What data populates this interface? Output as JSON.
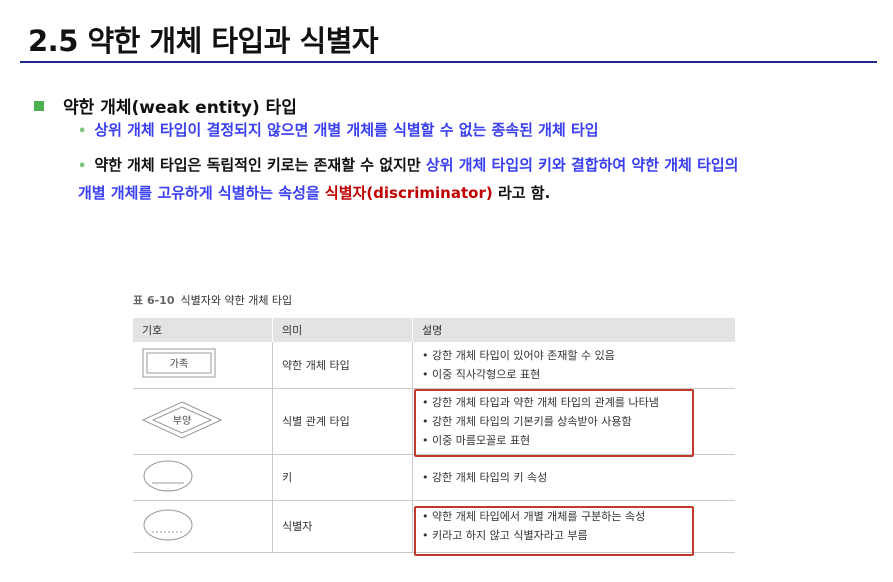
{
  "title": "2.5 약한 개체 타입과 식별자",
  "main_bullet": "약한 개체(weak entity) 타입",
  "sub1": "상위 개체 타입이 결정되지 않으면 개별 개체를 식별할 수 없는 종속된 개체 타입",
  "sub2": {
    "part1": "약한 개체 타입은 독립적인 키로는 존재할 수 없지만 ",
    "part2": "상위 개체 타입의 키와 결합하여 약한 개체 타입의",
    "part3": "개별 개체를 고유하게 식별하는 속성을 ",
    "part4": "식별자(discriminator)",
    "part5": " 라고 함."
  },
  "table": {
    "caption_num": "표 6-10",
    "caption_text": "식별자와 약한 개체 타입",
    "headers": [
      "기호",
      "의미",
      "설명"
    ],
    "rows": [
      {
        "symbol_text": "가족",
        "meaning": "약한 개체 타입",
        "desc": [
          "강한 개체 타입이 있어야 존재할 수 있음",
          "이중 직사각형으로 표현"
        ]
      },
      {
        "symbol_text": "부양",
        "meaning": "식별 관계 타입",
        "desc": [
          "강한 개체 타입과 약한 개체 타입의 관계를 나타냄",
          "강한 개체 타입의 기본키를 상속받아 사용함",
          "이중 마름모꼴로 표현"
        ]
      },
      {
        "symbol_text": "",
        "meaning": "키",
        "desc": [
          "강한 개체 타입의 키 속성"
        ]
      },
      {
        "symbol_text": "",
        "meaning": "식별자",
        "desc": [
          "약한 개체 타입에서 개별 개체를 구분하는 속성",
          "키라고 하지 않고 식별자라고 부름"
        ]
      }
    ]
  },
  "colors": {
    "accent_blue": "#3a3ff0",
    "accent_red": "#c00000",
    "bullet_green": "#4caf50",
    "title_rule": "#1f2a8a"
  }
}
